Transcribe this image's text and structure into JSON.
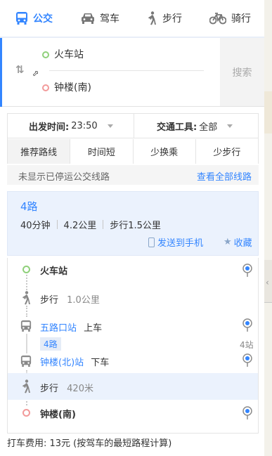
{
  "modes": [
    {
      "label": "公交",
      "icon": "bus-icon",
      "active": true
    },
    {
      "label": "驾车",
      "icon": "car-icon",
      "active": false
    },
    {
      "label": "步行",
      "icon": "walk-icon",
      "active": false
    },
    {
      "label": "骑行",
      "icon": "bike-icon",
      "active": false
    }
  ],
  "search": {
    "from": "火车站",
    "to": "钟楼(南)",
    "button": "搜索"
  },
  "options": {
    "time_label": "出发时间:",
    "time_value": "23:50",
    "tool_label": "交通工具:",
    "tool_value": "全部",
    "prefs": [
      "推荐路线",
      "时间短",
      "少换乘",
      "少步行"
    ]
  },
  "notice": {
    "text": "未显示已停运公交线路",
    "link": "查看全部线路"
  },
  "route": {
    "name": "4路",
    "duration": "40分钟",
    "distance": "4.2公里",
    "walk": "步行1.5公里",
    "send": "发送到手机",
    "favorite": "收藏"
  },
  "steps": {
    "start": "火车站",
    "walk1_label": "步行",
    "walk1_dist": "1.0公里",
    "board_station": "五路口站",
    "board_action": "上车",
    "line_tag": "4路",
    "stations": "4站",
    "alight_station": "钟楼(北)站",
    "alight_action": "下车",
    "walk2_label": "步行",
    "walk2_dist": "420米",
    "end": "钟楼(南)"
  },
  "footer": "打车费用: 13元  (按驾车的最短路程计算)",
  "colors": {
    "accent": "#3385ff",
    "start": "#8fd07a",
    "end": "#f29a9a"
  }
}
